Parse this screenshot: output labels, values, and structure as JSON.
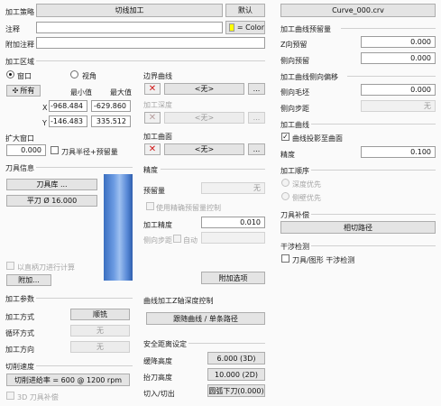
{
  "strategy": {
    "label": "加工策略",
    "value": "切线加工",
    "default_btn": "默认"
  },
  "note": {
    "label": "注释",
    "value": "",
    "color_btn": "= Color",
    "color": "#ffff00"
  },
  "extra_note": {
    "label": "附加注释",
    "value": ""
  },
  "file_btn": "Curve_000.crv",
  "region": {
    "title": "加工区域",
    "opt_window": "窗口",
    "opt_view": "视角",
    "all_btn": "所有",
    "min_header": "最小值",
    "max_header": "最大值",
    "x_label": "X",
    "y_label": "Y",
    "x_min": "-968.484",
    "x_max": "-629.860",
    "y_min": "-146.483",
    "y_max": "335.512",
    "expand_label": "扩大窗口",
    "expand_value": "0.000",
    "expand_check_label": "刀具半径+预留量"
  },
  "boundary": {
    "title": "边界曲线",
    "value": "<无>",
    "more": "...",
    "depth_title": "加工深度",
    "depth_value": "<无>",
    "depth_more": "...",
    "surface_title": "加工曲面",
    "surface_value": "<无>",
    "surface_more": "..."
  },
  "tool": {
    "title": "刀具信息",
    "library_btn": "刀具库 ...",
    "tool_name": "平刀 Ø 16.000",
    "straight_label": "以直柄刀进行计算",
    "attach_btn": "附加..."
  },
  "precision": {
    "title": "精度",
    "stock_label": "预留量",
    "stock_value": "无",
    "use_stock_label": "使用精确预留量控制",
    "accuracy_label": "加工精度",
    "accuracy_value": "0.010",
    "stepover_label": "侧向步距",
    "auto_label": "自动",
    "stepover_value": "",
    "extra_btn": "附加选项"
  },
  "params": {
    "title": "加工参数",
    "mode_label": "加工方式",
    "mode_value": "顺铣",
    "loop_label": "循环方式",
    "loop_value": "无",
    "dir_label": "加工方向",
    "dir_value": "无"
  },
  "cut_speed": {
    "title": "切削速度",
    "value": "切削进给率 = 600 @ 1200 rpm",
    "comp_label": "3D 刀具补偿"
  },
  "z_depth": {
    "title": "曲线加工Z轴深度控制",
    "btn": "跟随曲线 / 单条路径"
  },
  "safety": {
    "title": "安全距离设定",
    "clear_label": "缓降高度",
    "clear_value": "6.000 (3D)",
    "retract_label": "抬刀高度",
    "retract_value": "10.000 (2D)",
    "entry_label": "切入/切出",
    "entry_value": "圆弧下刀(0.000)"
  },
  "curve_stock": {
    "title": "加工曲线预留量",
    "z_label": "Z向预留",
    "z_value": "0.000",
    "side_label": "侧向预留",
    "side_value": "0.000"
  },
  "curve_side": {
    "title": "加工曲线侧向偏移",
    "rough_label": "侧向毛坯",
    "rough_value": "0.000",
    "step_label": "侧向步距",
    "step_value": "无"
  },
  "curve_proc": {
    "title": "加工曲线",
    "project_label": "曲线投影至曲面",
    "accuracy_label": "精度",
    "accuracy_value": "0.100"
  },
  "order": {
    "title": "加工顺序",
    "depth_first": "深度优先",
    "side_first": "侧壁优先"
  },
  "comp": {
    "title": "刀具补偿",
    "btn": "相切路径"
  },
  "interf": {
    "title": "干涉检测",
    "label": "刀具/图形 干涉检测"
  }
}
